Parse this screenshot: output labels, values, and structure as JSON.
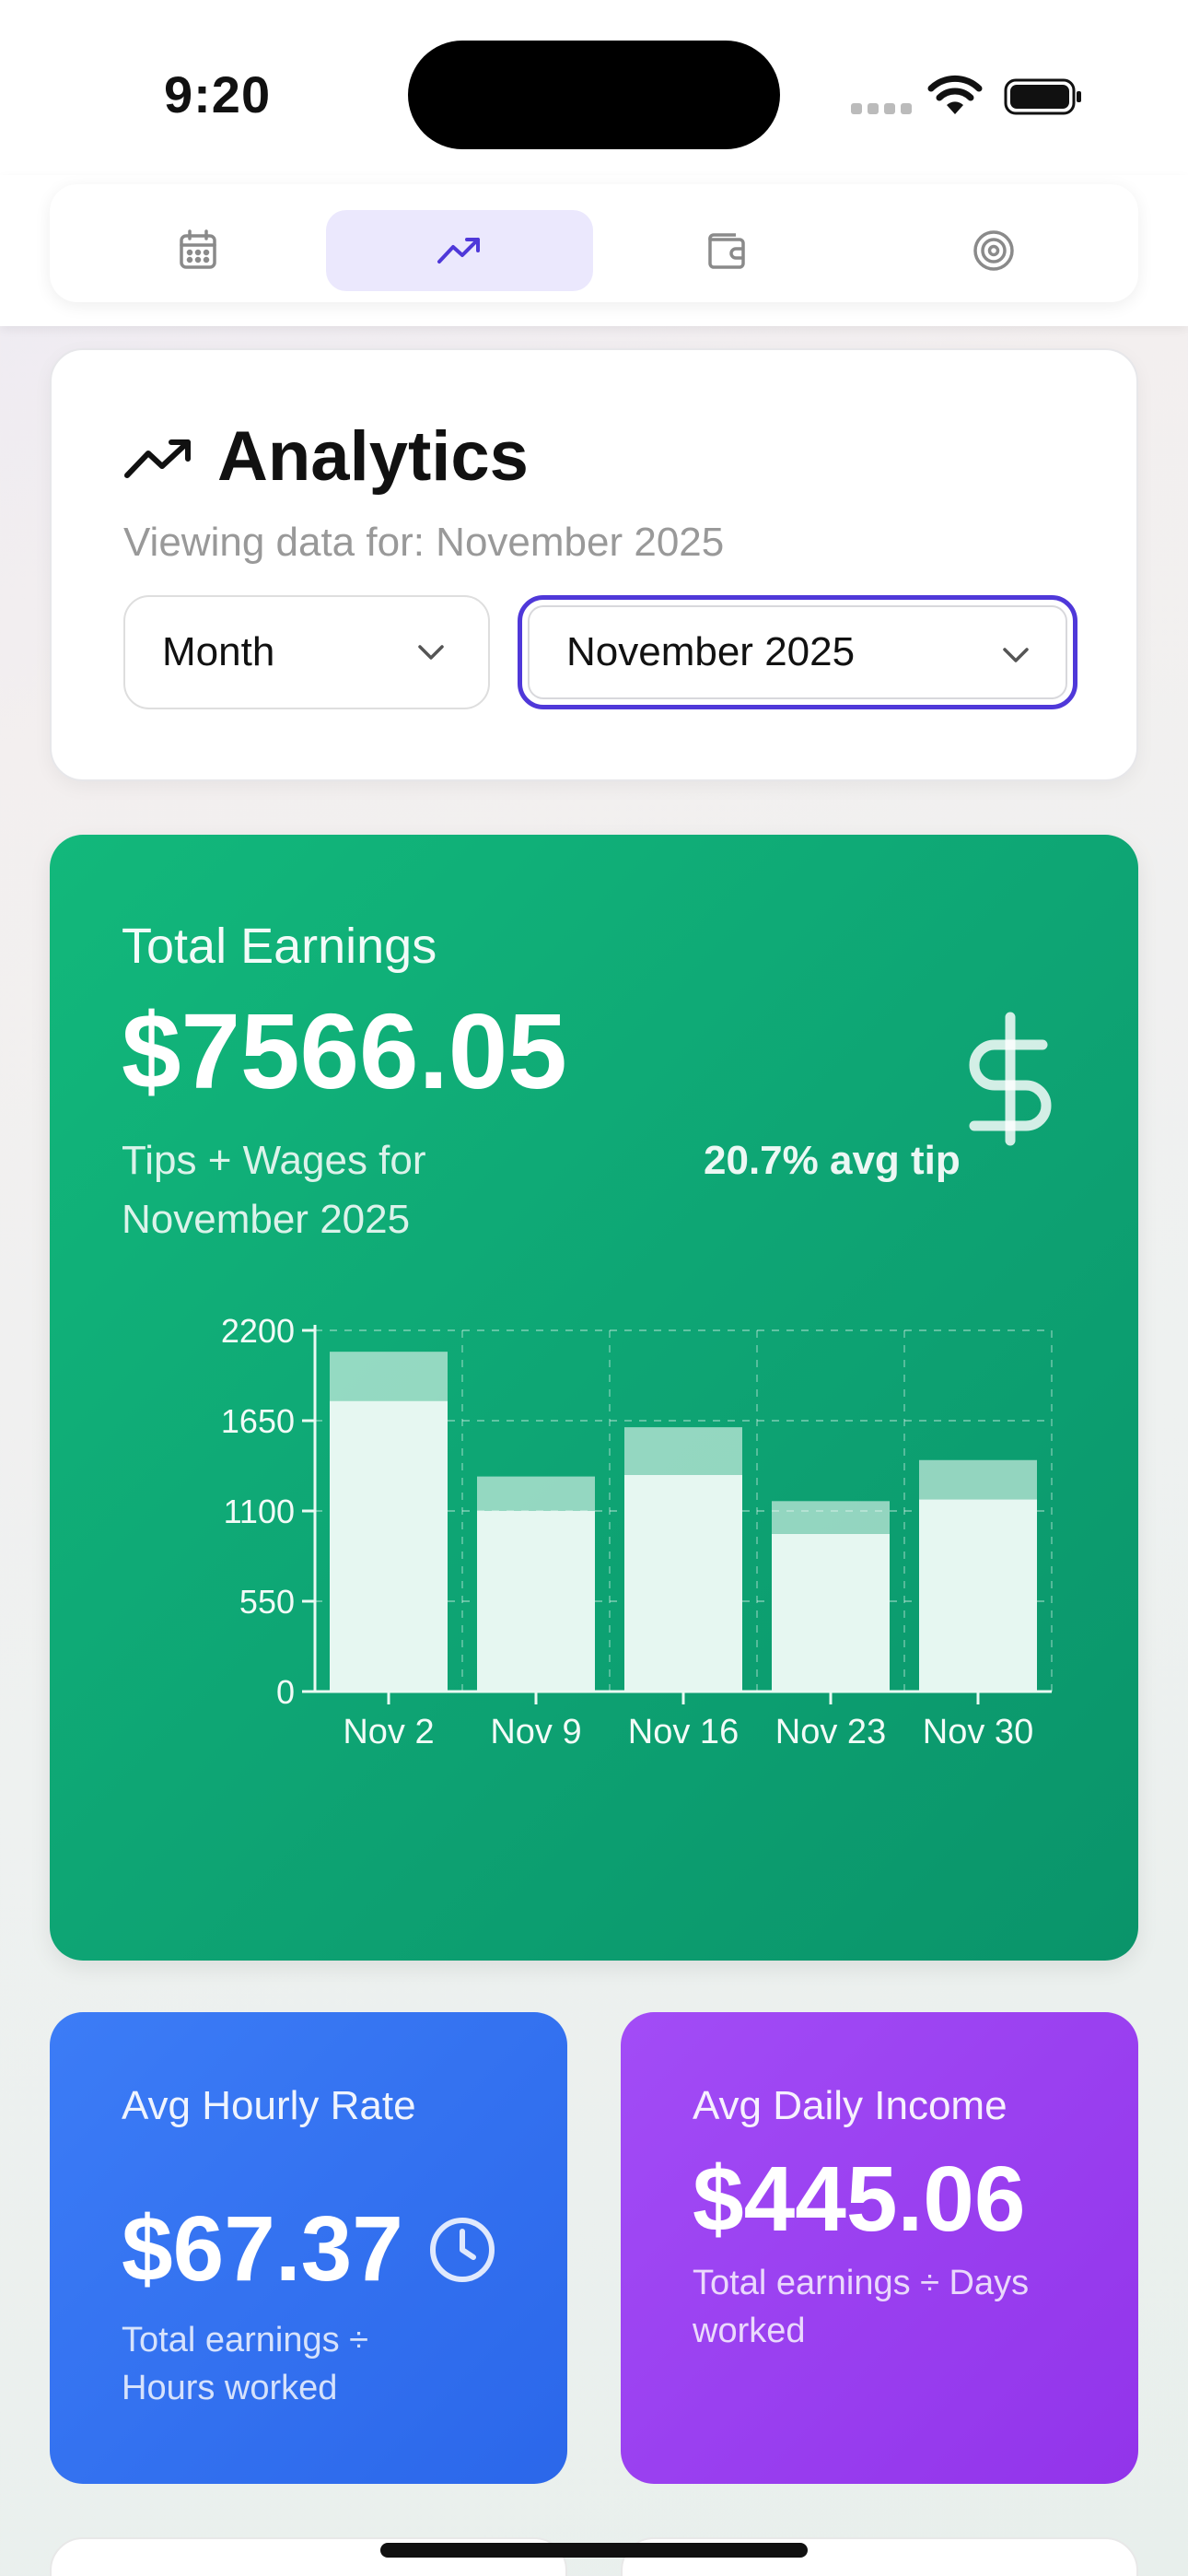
{
  "status": {
    "time": "9:20"
  },
  "nav": {
    "tabs": [
      {
        "icon": "calendar-icon",
        "active": false
      },
      {
        "icon": "trending-up-icon",
        "active": true
      },
      {
        "icon": "wallet-icon",
        "active": false
      },
      {
        "icon": "target-icon",
        "active": false
      }
    ],
    "accent": "#4f38d9"
  },
  "analytics": {
    "title": "Analytics",
    "subtitle": "Viewing data for: November 2025",
    "range_select": "Month",
    "period_select": "November 2025"
  },
  "earnings": {
    "label": "Total Earnings",
    "value": "$7566.05",
    "description": "Tips + Wages for November 2025",
    "tip_stat": "20.7% avg tip",
    "icon": "dollar-icon"
  },
  "chart_data": {
    "type": "bar",
    "stacked": true,
    "categories": [
      "Nov 2",
      "Nov 9",
      "Nov 16",
      "Nov 23",
      "Nov 30"
    ],
    "series": [
      {
        "values": [
          1770,
          1100,
          1320,
          960,
          1170
        ]
      },
      {
        "values": [
          300,
          210,
          290,
          200,
          240
        ]
      }
    ],
    "ylim": [
      0,
      2200
    ],
    "yticks": [
      0,
      550,
      1100,
      1650,
      2200
    ],
    "grid": true
  },
  "hourly": {
    "label": "Avg Hourly Rate",
    "value": "$67.37",
    "description": "Total earnings ÷ Hours worked",
    "icon": "clock-icon"
  },
  "daily": {
    "label": "Avg Daily Income",
    "value": "$445.06",
    "description": "Total earnings ÷ Days worked"
  }
}
